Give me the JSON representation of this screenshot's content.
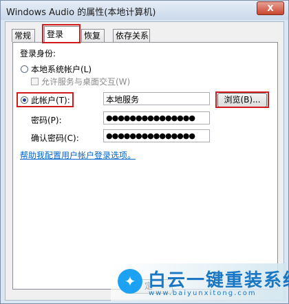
{
  "window": {
    "title": "Windows Audio 的属性(本地计算机)",
    "close_label": "X"
  },
  "tabs": [
    {
      "label": "常规"
    },
    {
      "label": "登录"
    },
    {
      "label": "恢复"
    },
    {
      "label": "依存关系"
    }
  ],
  "logon": {
    "section_label": "登录身份:",
    "local_system_label": "本地系统帐户(L)",
    "allow_desktop_label": "允许服务与桌面交互(W)",
    "this_account_label": "此帐户(T):",
    "account_value": "本地服务",
    "browse_label": "浏览(B)...",
    "password_label": "密码(P):",
    "password_value": "●●●●●●●●●●●●●●●",
    "confirm_label": "确认密码(C):",
    "confirm_value": "●●●●●●●●●●●●●●●",
    "help_link": "帮助我配置用户帐户登录选项。"
  },
  "footer": {
    "ok_label": "定"
  },
  "watermark": {
    "text": "白云一键重装系统",
    "url": "www.baiyunxitong.com"
  }
}
